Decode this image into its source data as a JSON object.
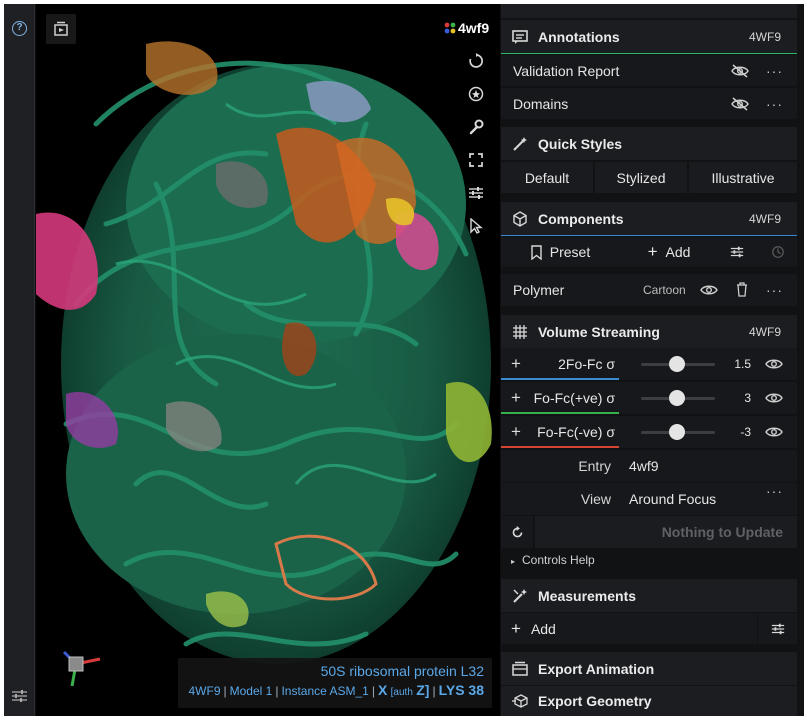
{
  "viewport": {
    "pdb_badge": "4wf9",
    "info": {
      "title": "50S ribosomal protein L32",
      "entry": "4WF9",
      "model": "Model 1",
      "instance": "Instance ASM_1",
      "chain": "X",
      "chain_auth_prefix": "[auth",
      "chain_auth": "Z]",
      "residue": "LYS 38"
    },
    "tool_icons": [
      "reset-view-icon",
      "toggle-spin-icon",
      "settings-wrench-icon",
      "fullscreen-icon",
      "viewport-controls-icon",
      "selection-mode-icon"
    ]
  },
  "panel": {
    "annotations": {
      "title": "Annotations",
      "tag": "4WF9",
      "items": [
        {
          "label": "Validation Report",
          "visible": false
        },
        {
          "label": "Domains",
          "visible": false
        }
      ]
    },
    "quick_styles": {
      "title": "Quick Styles",
      "buttons": [
        "Default",
        "Stylized",
        "Illustrative"
      ]
    },
    "components": {
      "title": "Components",
      "tag": "4WF9",
      "preset_label": "Preset",
      "add_label": "Add",
      "polymer": {
        "label": "Polymer",
        "representation": "Cartoon"
      }
    },
    "volume_streaming": {
      "title": "Volume Streaming",
      "tag": "4WF9",
      "channels": [
        {
          "name": "2Fo-Fc σ",
          "value": "1.5",
          "color": "#3a8bd1"
        },
        {
          "name": "Fo-Fc(+ve) σ",
          "value": "3",
          "color": "#35b04c"
        },
        {
          "name": "Fo-Fc(-ve) σ",
          "value": "-3",
          "color": "#d64532"
        }
      ],
      "entry_label": "Entry",
      "entry_value": "4wf9",
      "view_label": "View",
      "view_value": "Around Focus",
      "update_label": "Nothing to Update",
      "controls_help": "Controls Help"
    },
    "measurements": {
      "title": "Measurements",
      "add_label": "Add"
    },
    "export_animation": {
      "title": "Export Animation"
    },
    "export_geometry": {
      "title": "Export Geometry"
    }
  },
  "colors": {
    "accent": "#3a8bd1",
    "molecule_main": "#1e7a5c",
    "panel_bg": "#17181b"
  }
}
